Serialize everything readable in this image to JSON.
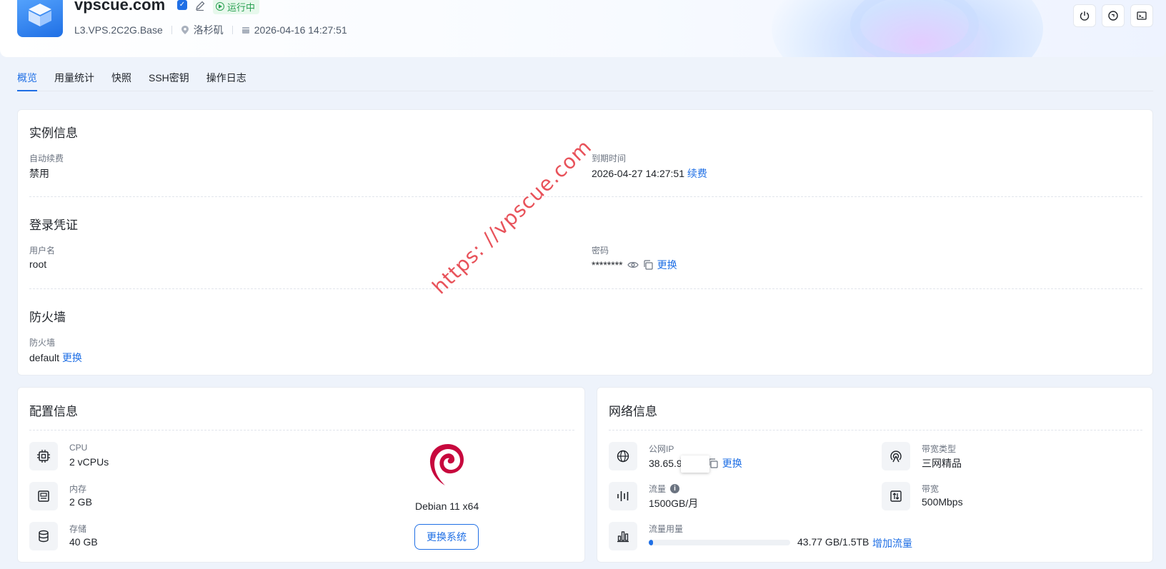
{
  "header": {
    "title": "vpscue.com",
    "status": "运行中",
    "plan": "L3.VPS.2C2G.Base",
    "location": "洛杉矶",
    "created": "2026-04-16 14:27:51"
  },
  "tabs": [
    {
      "label": "概览"
    },
    {
      "label": "用量统计"
    },
    {
      "label": "快照"
    },
    {
      "label": "SSH密钥"
    },
    {
      "label": "操作日志"
    }
  ],
  "instance": {
    "title": "实例信息",
    "auto_renew_label": "自动续费",
    "auto_renew_value": "禁用",
    "expire_label": "到期时间",
    "expire_value": "2026-04-27 14:27:51",
    "renew_link": "续费"
  },
  "login": {
    "title": "登录凭证",
    "username_label": "用户名",
    "username_value": "root",
    "password_label": "密码",
    "password_value": "********",
    "change_link": "更换"
  },
  "firewall": {
    "title": "防火墙",
    "label": "防火墙",
    "value": "default",
    "change_link": "更换"
  },
  "config": {
    "title": "配置信息",
    "cpu_label": "CPU",
    "cpu_value": "2 vCPUs",
    "mem_label": "内存",
    "mem_value": "2 GB",
    "disk_label": "存储",
    "disk_value": "40 GB",
    "os_name": "Debian 11 x64",
    "change_os_button": "更换系统"
  },
  "network": {
    "title": "网络信息",
    "ip_label": "公网IP",
    "ip_value": "38.65.9",
    "ip_change_link": "更换",
    "bw_type_label": "带宽类型",
    "bw_type_value": "三网精品",
    "traffic_label": "流量",
    "traffic_value": "1500GB/月",
    "bandwidth_label": "带宽",
    "bandwidth_value": "500Mbps",
    "usage_label": "流量用量",
    "usage_text": "43.77 GB/1.5TB",
    "usage_fraction": 0.029,
    "add_traffic_link": "增加流量"
  },
  "watermark": "https: //vpscue.com",
  "colors": {
    "accent": "#1f6fe5",
    "running": "#2aa052",
    "watermark": "#e8525a"
  }
}
